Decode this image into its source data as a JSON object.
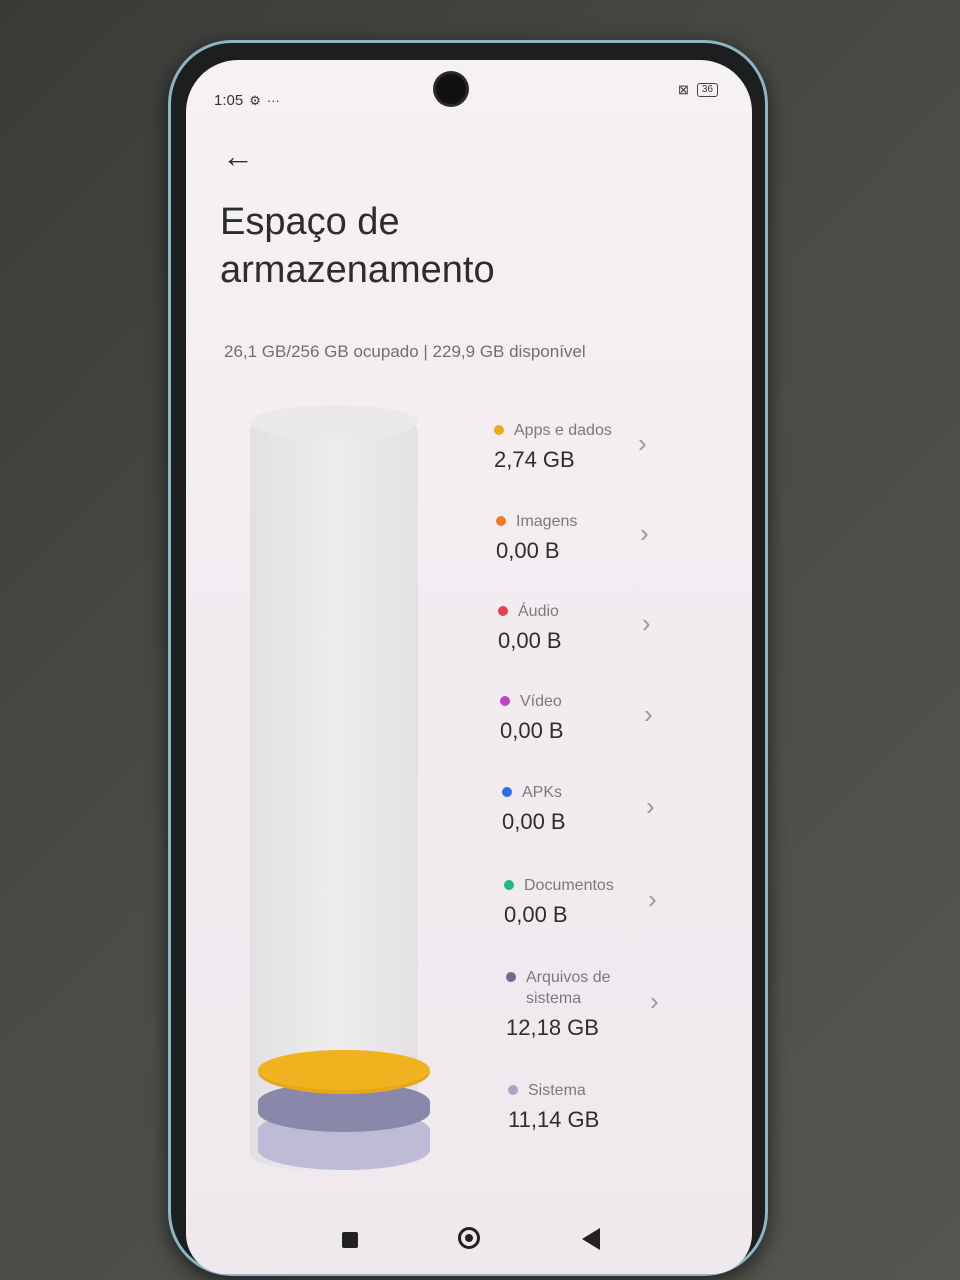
{
  "status": {
    "time": "1:05",
    "battery": "36"
  },
  "page": {
    "title_line1": "Espaço de",
    "title_line2": "armazenamento",
    "summary": "26,1 GB/256 GB ocupado | 229,9 GB disponível"
  },
  "categories": [
    {
      "label": "Apps e dados",
      "value": "2,74 GB",
      "color": "#f0a81c"
    },
    {
      "label": "Imagens",
      "value": "0,00 B",
      "color": "#f07a2a"
    },
    {
      "label": "Áudio",
      "value": "0,00 B",
      "color": "#e8404a"
    },
    {
      "label": "Vídeo",
      "value": "0,00 B",
      "color": "#c040c8"
    },
    {
      "label": "APKs",
      "value": "0,00 B",
      "color": "#2a70e8"
    },
    {
      "label": "Documentos",
      "value": "0,00 B",
      "color": "#20b884"
    },
    {
      "label": "Arquivos de sistema",
      "value": "12,18 GB",
      "color": "#6e6c92"
    },
    {
      "label": "Sistema",
      "value": "11,14 GB",
      "color": "#a8a6c6"
    }
  ]
}
